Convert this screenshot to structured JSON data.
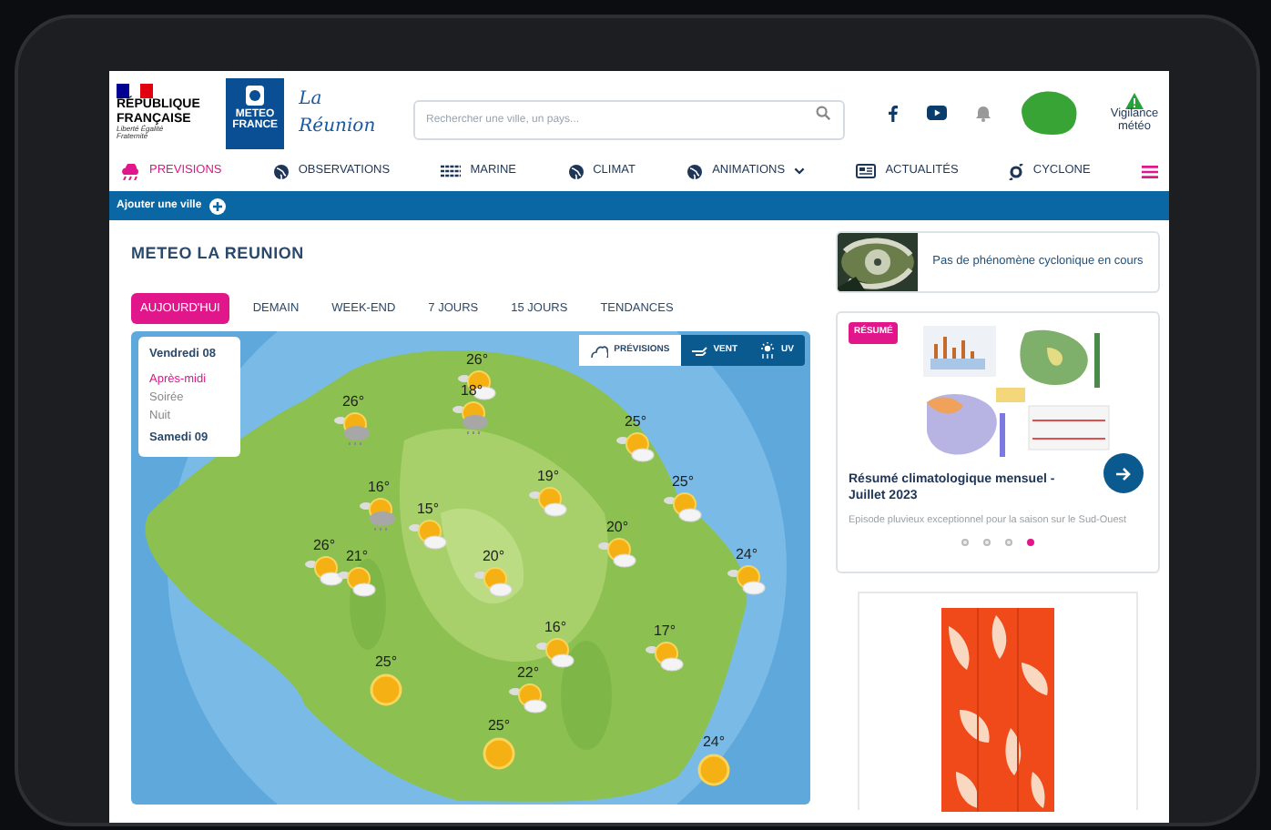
{
  "header": {
    "republic": {
      "name": "RÉPUBLIQUE FRANÇAISE",
      "motto": "Liberté Égalité Fraternité"
    },
    "brand": "METEO FRANCE",
    "region": "La Réunion",
    "search": {
      "placeholder": "Rechercher une ville, un pays..."
    },
    "vigilance": "Vigilance météo"
  },
  "nav": [
    {
      "label": "PREVISIONS",
      "selected": true,
      "dropdown": false,
      "kind": "rain"
    },
    {
      "label": "OBSERVATIONS",
      "selected": false,
      "dropdown": false,
      "kind": "globe"
    },
    {
      "label": "MARINE",
      "selected": false,
      "dropdown": false,
      "kind": "waves"
    },
    {
      "label": "CLIMAT",
      "selected": false,
      "dropdown": false,
      "kind": "globe"
    },
    {
      "label": "ANIMATIONS",
      "selected": false,
      "dropdown": true,
      "kind": "globe"
    },
    {
      "label": "ACTUALITÉS",
      "selected": false,
      "dropdown": false,
      "kind": "news"
    },
    {
      "label": "CYCLONE",
      "selected": false,
      "dropdown": false,
      "kind": "cyclone"
    }
  ],
  "city_bar": {
    "label": "Ajouter une ville"
  },
  "page_title": "METEO LA REUNION",
  "periods": [
    {
      "label": "AUJOURD'HUI",
      "selected": true
    },
    {
      "label": "DEMAIN",
      "selected": false
    },
    {
      "label": "WEEK-END",
      "selected": false
    },
    {
      "label": "7 JOURS",
      "selected": false
    },
    {
      "label": "15 JOURS",
      "selected": false
    },
    {
      "label": "TENDANCES",
      "selected": false
    }
  ],
  "day_panel": {
    "days": [
      {
        "label": "Vendredi 08",
        "slots": [
          {
            "label": "Après-midi",
            "selected": true
          },
          {
            "label": "Soirée",
            "selected": false
          },
          {
            "label": "Nuit",
            "selected": false
          }
        ]
      },
      {
        "label": "Samedi 09"
      }
    ]
  },
  "map_modes": [
    {
      "label": "PRÉVISIONS",
      "selected": true
    },
    {
      "label": "VENT",
      "selected": false
    },
    {
      "label": "UV",
      "selected": false
    }
  ],
  "map_markers": [
    {
      "temp": "26°",
      "kind": "sun-cloud"
    },
    {
      "temp": "18°",
      "kind": "rain"
    },
    {
      "temp": "26°",
      "kind": "rain"
    },
    {
      "temp": "25°",
      "kind": "sun-cloud"
    },
    {
      "temp": "19°",
      "kind": "sun-cloud"
    },
    {
      "temp": "25°",
      "kind": "sun-cloud"
    },
    {
      "temp": "16°",
      "kind": "rain"
    },
    {
      "temp": "15°",
      "kind": "sun-cloud"
    },
    {
      "temp": "20°",
      "kind": "sun-cloud"
    },
    {
      "temp": "26°",
      "kind": "sun-cloud"
    },
    {
      "temp": "21°",
      "kind": "sun-cloud"
    },
    {
      "temp": "20°",
      "kind": "sun-cloud"
    },
    {
      "temp": "24°",
      "kind": "sun-cloud"
    },
    {
      "temp": "16°",
      "kind": "sun-cloud"
    },
    {
      "temp": "17°",
      "kind": "sun-cloud"
    },
    {
      "temp": "22°",
      "kind": "sun-cloud"
    },
    {
      "temp": "25°",
      "kind": "sun"
    },
    {
      "temp": "25°",
      "kind": "sun"
    },
    {
      "temp": "24°",
      "kind": "sun"
    }
  ],
  "cyclone_card": {
    "text": "Pas de phénomène cyclonique en cours"
  },
  "news_card": {
    "badge": "RÉSUMÉ",
    "title": "Résumé climatologique mensuel - Juillet 2023",
    "summary": "Episode pluvieux exceptionnel pour la saison sur le Sud-Ouest",
    "dots": [
      {
        "selected": false
      },
      {
        "selected": false
      },
      {
        "selected": false
      },
      {
        "selected": true
      }
    ]
  }
}
